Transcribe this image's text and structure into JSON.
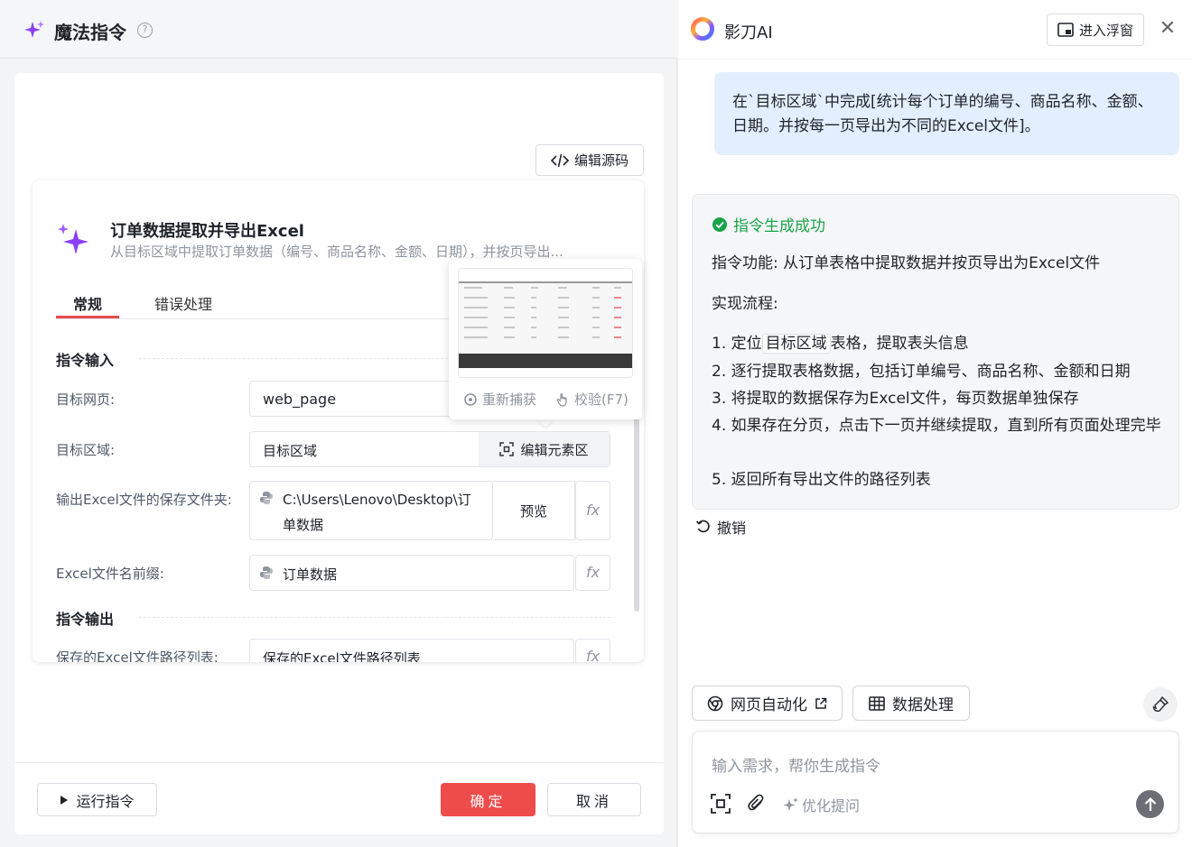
{
  "left": {
    "title": "魔法指令",
    "edit_source": "编辑源码",
    "card_title": "订单数据提取并导出Excel",
    "card_desc": "从目标区域中提取订单数据（编号、商品名称、金额、日期），并按页导出...",
    "tabs": [
      "常规",
      "错误处理"
    ],
    "section_input": "指令输入",
    "section_output": "指令输出",
    "fields": {
      "page_label": "目标网页:",
      "page_value": "web_page",
      "area_label": "目标区域:",
      "area_value": "目标区域",
      "area_button": "编辑元素区",
      "folder_label": "输出Excel文件的保存文件夹:",
      "folder_value": "C:\\Users\\Lenovo\\Desktop\\订单数据",
      "folder_preview": "预览",
      "prefix_label": "Excel文件名前缀:",
      "prefix_value": "订单数据",
      "output_label": "保存的Excel文件路径列表:",
      "output_value": "保存的Excel文件路径列表",
      "fx": "fx"
    },
    "popover": {
      "recapture": "重新捕获",
      "verify": "校验(F7)"
    },
    "run_button": "运行指令",
    "ok_button": "确定",
    "cancel_button": "取消"
  },
  "right": {
    "title": "影刀AI",
    "float_button": "进入浮窗",
    "user_message": "在`目标区域`中完成[统计每个订单的编号、商品名称、金额、日期。并按每一页导出为不同的Excel文件]。",
    "success": "指令生成成功",
    "function_line": "指令功能:   从订单表格中提取数据并按页导出为Excel文件",
    "flow_title": "实现流程:",
    "steps": {
      "s1_prefix": "1. 定位",
      "s1_tag": "目标区域",
      "s1_suffix": "表格，提取表头信息",
      "s2": "2. 逐行提取表格数据，包括订单编号、商品名称、金额和日期",
      "s3": "3. 将提取的数据保存为Excel文件，每页数据单独保存",
      "s4": "4. 如果存在分页，点击下一页并继续提取，直到所有页面处理完毕",
      "s5": "5. 返回所有导出文件的路径列表"
    },
    "undo": "撤销",
    "chips": [
      "网页自动化",
      "数据处理"
    ],
    "input_placeholder": "输入需求，帮你生成指令",
    "optimize": "优化提问"
  },
  "colors": {
    "accent_red": "#ee4b4b",
    "success_green": "#1aa34a",
    "bubble_blue": "#e3eeff",
    "sparkle_purple": "#8a3ffc"
  },
  "icons": [
    "sparkle-icon",
    "help-icon",
    "code-icon",
    "python-icon",
    "crosshair-icon",
    "hand-icon",
    "play-icon",
    "ai-logo-icon",
    "window-icon",
    "close-icon",
    "check-circle-icon",
    "undo-icon",
    "chrome-icon",
    "external-link-icon",
    "table-icon",
    "brush-icon",
    "screenshot-icon",
    "paperclip-icon",
    "arrow-up-icon"
  ]
}
